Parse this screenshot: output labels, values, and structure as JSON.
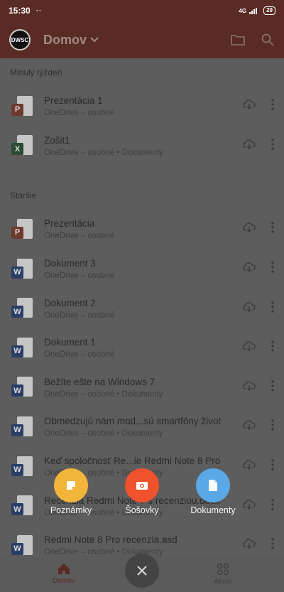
{
  "status_bar": {
    "time": "15:30",
    "dots": "··",
    "network": "4G",
    "battery": "29"
  },
  "header": {
    "avatar_text": "DWSC",
    "title": "Domov"
  },
  "sections": [
    {
      "title": "Minulý týždeň",
      "items": [
        {
          "name": "Prezentácia 1",
          "location": "OneDrive – osobné",
          "type": "ppt"
        },
        {
          "name": "Zošit1",
          "location": "OneDrive – osobné • Dokumenty",
          "type": "xls"
        }
      ]
    },
    {
      "title": "Staršie",
      "items": [
        {
          "name": "Prezentácia",
          "location": "OneDrive – osobné",
          "type": "ppt"
        },
        {
          "name": "Dokument 3",
          "location": "OneDrive – osobné",
          "type": "doc"
        },
        {
          "name": "Dokument 2",
          "location": "OneDrive – osobné",
          "type": "doc"
        },
        {
          "name": "Dokument 1",
          "location": "OneDrive – osobné",
          "type": "doc"
        },
        {
          "name": "Bežíte ešte na Windows 7",
          "location": "OneDrive – osobné • Dokumenty",
          "type": "doc"
        },
        {
          "name": "Obmedzujú nám mod...sú smartfóny život",
          "location": "OneDrive – osobné • Dokumenty",
          "type": "doc"
        },
        {
          "name": "Keď spoločnosť Re...ie Redmi Note 8 Pro",
          "location": "OneDrive – osobné • Dokumenty",
          "type": "doc"
        },
        {
          "name": "Recenzia Redmi Note 7 s recenziou.docx",
          "location": "OneDrive – osobné • Dokumenty",
          "type": "doc"
        },
        {
          "name": "Redmi Note 8 Pro recenzia.asd",
          "location": "OneDrive – osobné • Dokumenty",
          "type": "doc"
        }
      ]
    }
  ],
  "speed_dial": [
    {
      "label": "Poznámky",
      "color": "#f2b53a"
    },
    {
      "label": "Šošovky",
      "color": "#f0522d"
    },
    {
      "label": "Dokumenty",
      "color": "#5aa9e6"
    }
  ],
  "bottom_nav": {
    "home": "Domov",
    "actions": "Akcie"
  },
  "colors": {
    "brand": "#5a2b24",
    "scrim": "#5d5d5d"
  }
}
